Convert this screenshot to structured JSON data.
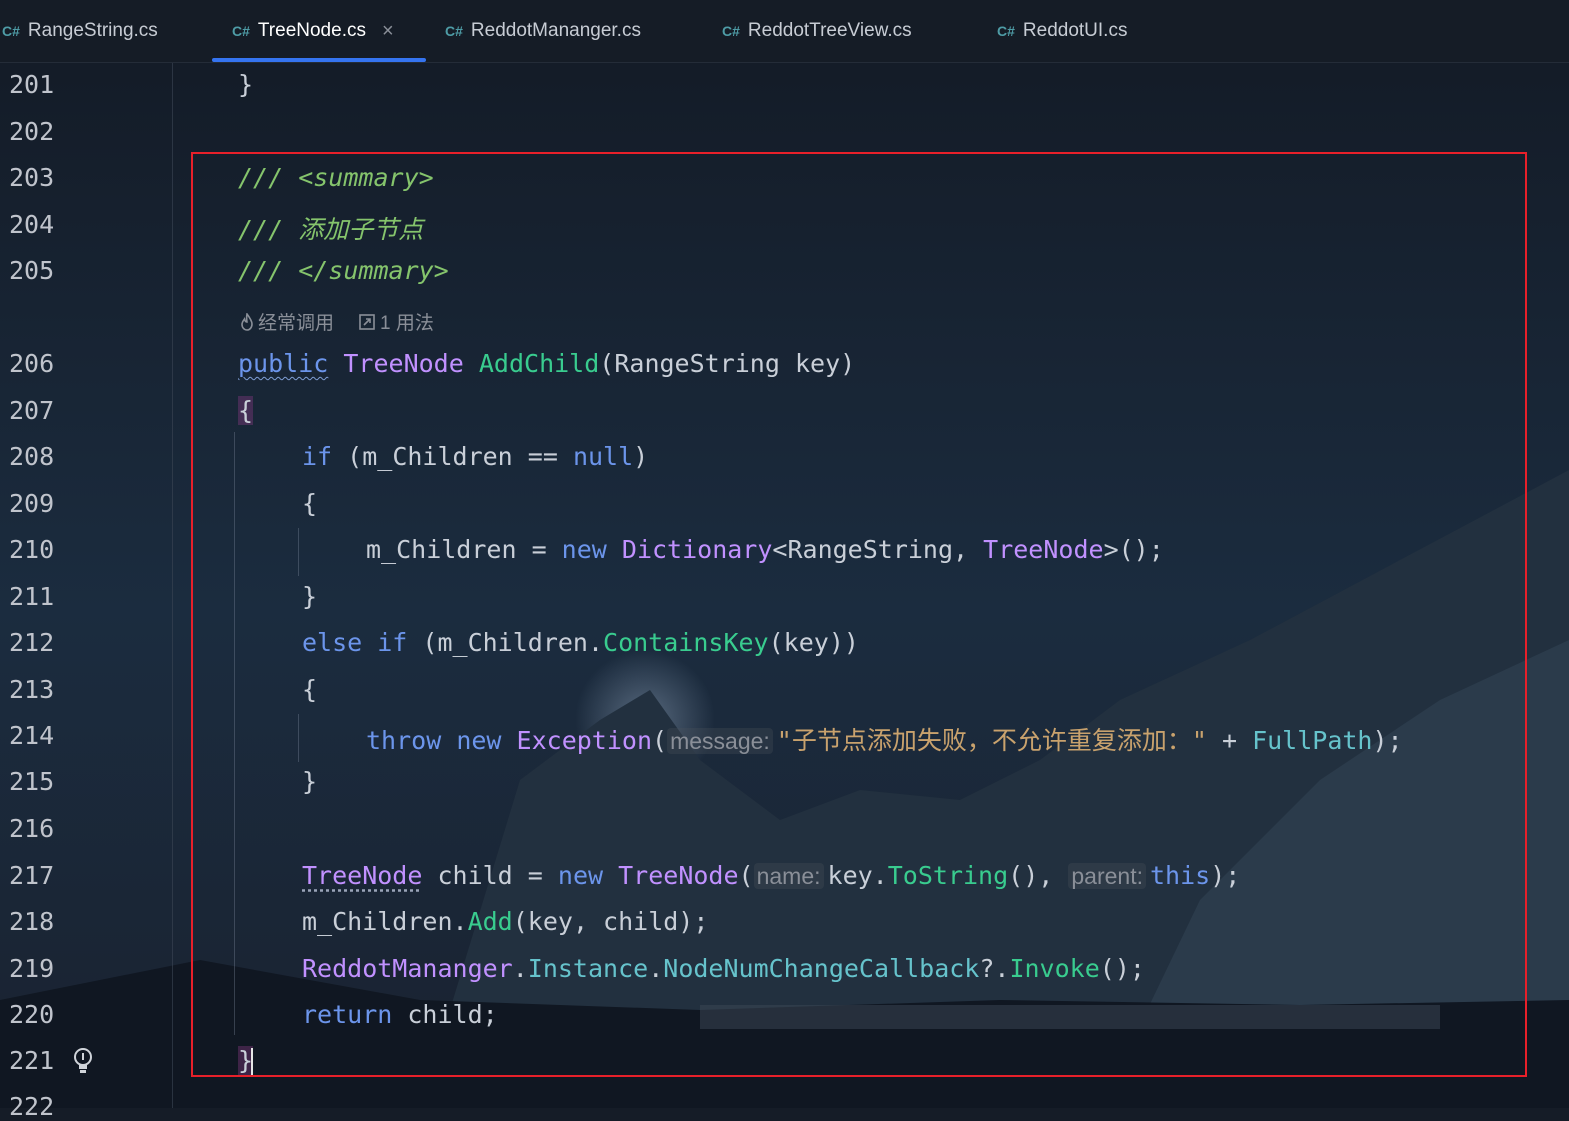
{
  "tabs": [
    {
      "lang": "C#",
      "name": "RangeString.cs"
    },
    {
      "lang": "C#",
      "name": "TreeNode.cs",
      "active": true,
      "close": "×"
    },
    {
      "lang": "C#",
      "name": "ReddotMananger.cs"
    },
    {
      "lang": "C#",
      "name": "ReddotTreeView.cs"
    },
    {
      "lang": "C#",
      "name": "ReddotUI.cs"
    }
  ],
  "line_numbers": [
    "201",
    "202",
    "203",
    "204",
    "205",
    "206",
    "207",
    "208",
    "209",
    "210",
    "211",
    "212",
    "213",
    "214",
    "215",
    "216",
    "217",
    "218",
    "219",
    "220",
    "221",
    "222"
  ],
  "code_vision": {
    "frequent": "经常调用",
    "usages": "1 用法"
  },
  "tok": {
    "brace_close": "}",
    "brace_open": "{",
    "comment_summary_open": "/// <summary>",
    "comment_desc": "/// 添加子节点",
    "comment_summary_close": "/// </summary>",
    "public": "public",
    "TreeNode": "TreeNode",
    "AddChild": "AddChild",
    "open_paren": "(",
    "RangeString": "RangeString",
    "key_close": " key)",
    "if": "if",
    "if_cond": " (m_Children == ",
    "null": "null",
    "close_paren": ")",
    "m_children_assign": "m_Children = ",
    "new": "new",
    "Dictionary": "Dictionary",
    "lt": "<",
    "comma": ", ",
    "gt_call": ">();",
    "else_if": "else if",
    "paren_m_children_dot": " (m_Children.",
    "ContainsKey": "ContainsKey",
    "key_args_close": "(key))",
    "throw": "throw",
    "Exception": "Exception",
    "hint_message": "message:",
    "exception_msg": "\"子节点添加失败，不允许重复添加：\"",
    "plus": " + ",
    "FullPath": "FullPath",
    "close_semi": ");",
    "child_assign": " child = ",
    "hint_name": "name:",
    "key_dot": "key.",
    "ToString": "ToString",
    "call_comma": "(), ",
    "hint_parent": "parent:",
    "this": "this",
    "m_children_dot": "m_Children.",
    "Add": "Add",
    "add_args": "(key, child);",
    "ReddotMananger": "ReddotMananger",
    "dot": ".",
    "Instance": "Instance",
    "NodeNumChangeCallback": "NodeNumChangeCallback",
    "null_cond": "?.",
    "Invoke": "Invoke",
    "call_semi": "();",
    "return": "return",
    "child_semi": " child;"
  },
  "colors": {
    "keyword": "#6c95eb",
    "type": "#c191ff",
    "method": "#39cc8f",
    "property": "#66c3cc",
    "string": "#c9a26d",
    "comment": "#85c46c",
    "highlight_border": "#e8202a",
    "active_tab_underline": "#3574f0"
  },
  "icons": {
    "tab_lang": "csharp-icon",
    "code_vision_frequent": "flame-icon",
    "code_vision_usages": "usages-icon",
    "gutter": "lightbulb-icon"
  }
}
